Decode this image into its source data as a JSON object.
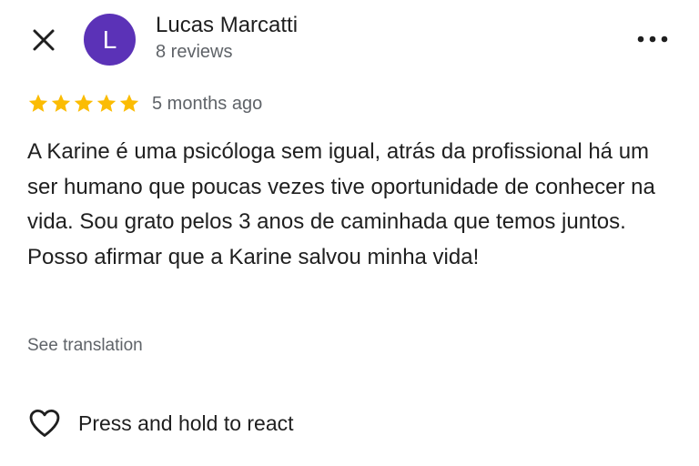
{
  "reviewer": {
    "avatar_initial": "L",
    "name": "Lucas Marcatti",
    "review_count": "8 reviews"
  },
  "review": {
    "rating": 5,
    "rating_max": 5,
    "date": "5 months ago",
    "text": "A Karine é uma psicóloga sem igual, atrás da profissional há um ser humano que poucas vezes tive oportunidade de conhecer na vida. Sou grato pelos 3 anos de caminhada que temos juntos. Posso afirmar que a Karine salvou minha vida!",
    "see_translation": "See translation"
  },
  "actions": {
    "react_label": "Press and hold to react"
  },
  "icons": {
    "close": "close-icon",
    "more": "more-horizontal-icon",
    "star": "star-icon",
    "heart": "heart-outline-icon"
  },
  "colors": {
    "avatar_bg": "#5b32b7",
    "star": "#fbbc04",
    "secondary_text": "#5f6368",
    "primary_text": "#1f1f1f"
  }
}
